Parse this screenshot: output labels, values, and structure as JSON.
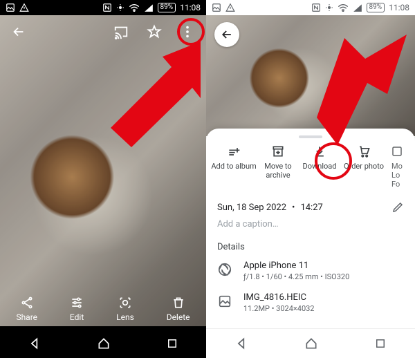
{
  "statusbar": {
    "battery": "89%",
    "clock": "11:08"
  },
  "left": {
    "bottom": {
      "share": "Share",
      "edit": "Edit",
      "lens": "Lens",
      "delete": "Delete"
    }
  },
  "sheet": {
    "actions": {
      "add_to_album": "Add to album",
      "move_to_archive_l1": "Move to",
      "move_to_archive_l2": "archive",
      "download": "Download",
      "order_photo": "Order photo",
      "more_l1": "Mo",
      "more_l2": "Lo",
      "more_l3": "Fo"
    },
    "date": "Sun, 18 Sep 2022",
    "sep": "•",
    "time": "14:27",
    "caption_placeholder": "Add a caption…",
    "details_heading": "Details",
    "camera": {
      "model": "Apple iPhone 11",
      "exif": "ƒ/1.8  •  1/60  •  4.25 mm  •  ISO320"
    },
    "file": {
      "name": "IMG_4816.HEIC",
      "meta": "11.2MP • 3024×4032"
    }
  }
}
